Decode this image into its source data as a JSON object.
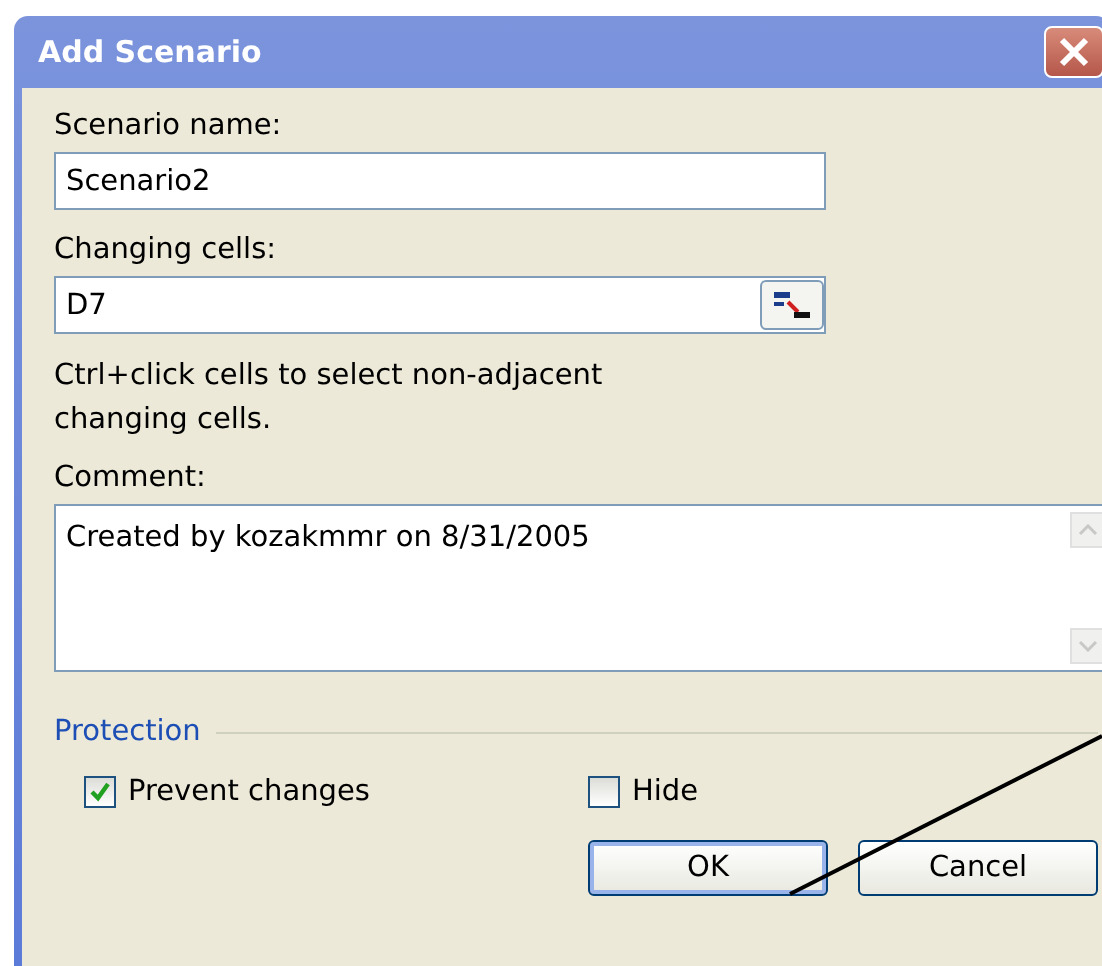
{
  "window": {
    "title": "Add Scenario"
  },
  "scenario_name": {
    "label": "Scenario name:",
    "value": "Scenario2"
  },
  "changing_cells": {
    "label": "Changing cells:",
    "value": "D7"
  },
  "hint": "Ctrl+click cells to select non-adjacent changing cells.",
  "comment": {
    "label": "Comment:",
    "value": "Created by kozakmmr on 8/31/2005"
  },
  "protection": {
    "title": "Protection",
    "options": [
      {
        "label": "Prevent changes",
        "checked": true
      },
      {
        "label": "Hide",
        "checked": false
      }
    ]
  },
  "buttons": [
    {
      "label": "OK",
      "default": true
    },
    {
      "label": "Cancel",
      "default": false
    }
  ]
}
